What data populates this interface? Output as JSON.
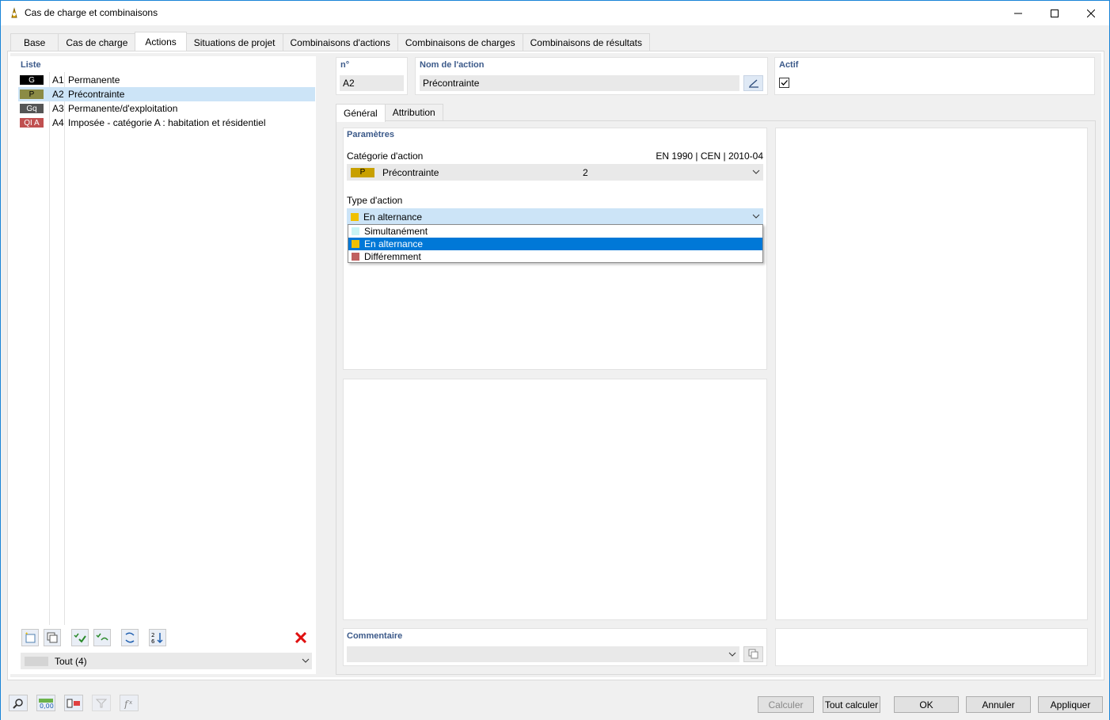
{
  "window": {
    "title": "Cas de charge et combinaisons"
  },
  "tabs": [
    "Base",
    "Cas de charge",
    "Actions",
    "Situations de projet",
    "Combinaisons d'actions",
    "Combinaisons de charges",
    "Combinaisons de résultats"
  ],
  "left": {
    "header": "Liste",
    "items": [
      {
        "badge": "G",
        "color": "#000000",
        "id": "A1",
        "name": "Permanente"
      },
      {
        "badge": "P",
        "color": "#8b8b45",
        "id": "A2",
        "name": "Précontrainte"
      },
      {
        "badge": "Gq",
        "color": "#555555",
        "id": "A3",
        "name": "Permanente/d'exploitation"
      },
      {
        "badge": "QI A",
        "color": "#c05050",
        "id": "A4",
        "name": "Imposée - catégorie A : habitation et résidentiel"
      }
    ],
    "filter": "Tout (4)"
  },
  "header": {
    "no_label": "n°",
    "no_value": "A2",
    "name_label": "Nom de l'action",
    "name_value": "Précontrainte",
    "active_label": "Actif"
  },
  "subtabs": [
    "Général",
    "Attribution"
  ],
  "params": {
    "title": "Paramètres",
    "category_label": "Catégorie d'action",
    "norm": "EN 1990 | CEN | 2010-04",
    "category_badge": "P",
    "category_badge_color": "#c8a000",
    "category_name": "Précontrainte",
    "category_code": "2",
    "type_label": "Type d'action",
    "type_value": "En alternance",
    "type_color": "#f0c000",
    "options": [
      {
        "label": "Simultanément",
        "color": "#c8f4f4"
      },
      {
        "label": "En alternance",
        "color": "#f0c000"
      },
      {
        "label": "Différemment",
        "color": "#c06060"
      }
    ]
  },
  "comment": {
    "label": "Commentaire"
  },
  "footer": {
    "calc": "Calculer",
    "calc_all": "Tout calculer",
    "ok": "OK",
    "cancel": "Annuler",
    "apply": "Appliquer"
  }
}
